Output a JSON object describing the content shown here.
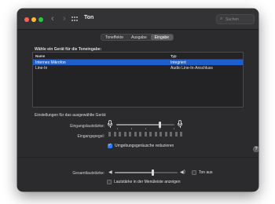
{
  "window": {
    "title": "Ton",
    "search_placeholder": "Suchen"
  },
  "tabs": [
    {
      "label": "Toneffekte",
      "active": false
    },
    {
      "label": "Ausgabe",
      "active": false
    },
    {
      "label": "Eingabe",
      "active": true
    }
  ],
  "device_section": {
    "label": "Wähle ein Gerät für die Toneingabe:",
    "columns": [
      "Name",
      "Typ"
    ],
    "rows": [
      {
        "name": "Internes Mikrofon",
        "type": "Integriert",
        "selected": true
      },
      {
        "name": "Line-In",
        "type": "Audio Line-In-Anschluss",
        "selected": false
      }
    ]
  },
  "settings": {
    "label": "Einstellungen für das ausgewählte Gerät:",
    "input_volume_label": "Eingangslautstärke:",
    "input_volume_level": 0.75,
    "input_level_label": "Eingangspegel:",
    "input_level_active_segments": 0,
    "noise_reduction_label": "Umgebungsgeräusche reduzieren",
    "noise_reduction_checked": true
  },
  "output": {
    "total_volume_label": "Gesamtlautstärke:",
    "total_volume_level": 0.6,
    "mute_label": "Ton aus",
    "mute_checked": false,
    "menu_bar_label": "Lautstärke in der Menüleiste anzeigen",
    "menu_bar_checked": false
  },
  "icons": {
    "back": "chevron-left-icon",
    "forward": "chevron-right-icon",
    "grid": "grid-icon",
    "search": "search-icon",
    "mic": "microphone-icon",
    "speaker": "speaker-icon",
    "help": "help-icon"
  },
  "colors": {
    "window_bg": "#2b2b2d",
    "selection": "#1f5fcc",
    "checkbox_on": "#2f7cf6",
    "close": "#ff5f57",
    "minimize": "#febc2e",
    "maximize": "#28c840"
  }
}
